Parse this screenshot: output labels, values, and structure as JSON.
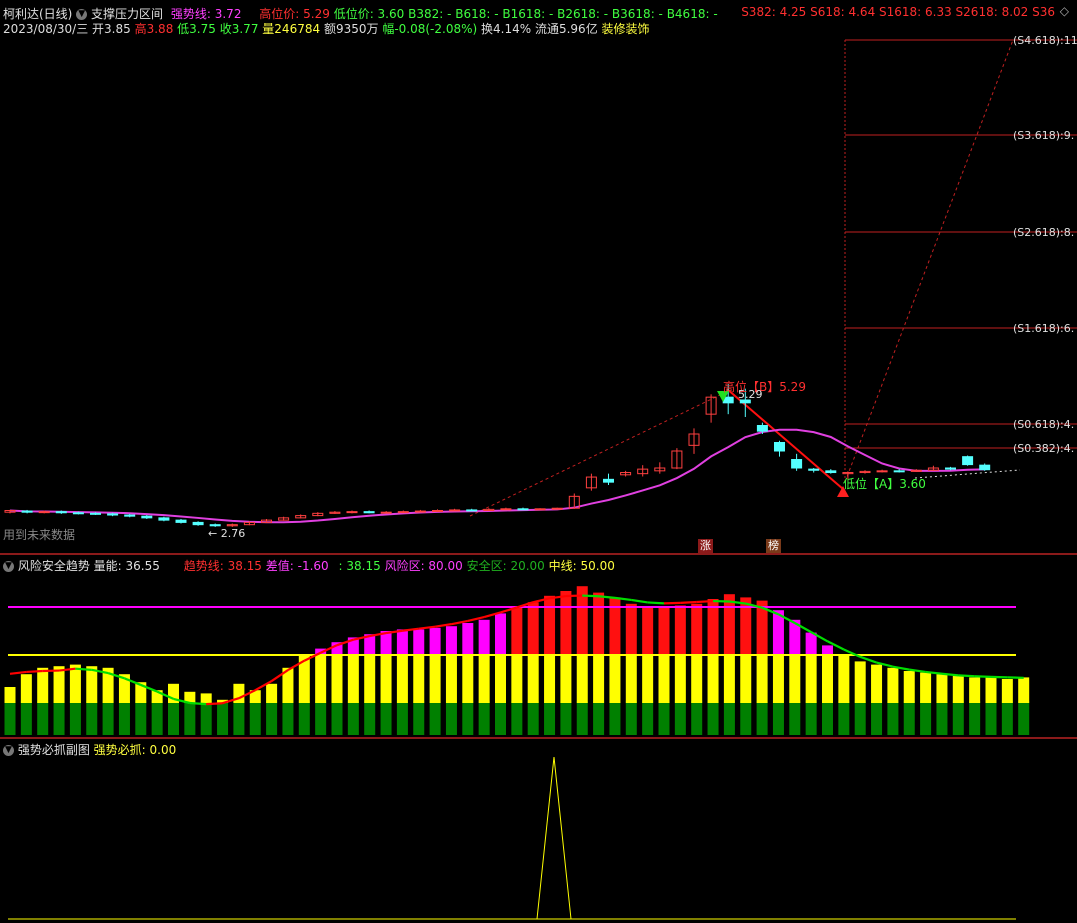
{
  "header": {
    "stock_name": "柯利达(日线)",
    "indicator_name": "支撑压力区间",
    "strong_line": "强势线: 3.72",
    "high_price": "高位价: 5.29",
    "low_price": "低位价: 3.60",
    "b_levels": "B382: -  B618: -  B1618: -  B2618: -  B3618: -  B4618: -",
    "s_levels": "S382: 4.25  S618: 4.64  S1618: 6.33  S2618: 8.02  S36",
    "date": "2023/08/30/三",
    "open": "开3.85",
    "high": "高3.88",
    "low": "低3.75",
    "close": "收3.77",
    "volume": "量246784",
    "amount": "额9350万",
    "change": "幅-0.08(-2.08%)",
    "turnover": "换4.14%",
    "float_cap": "流通5.96亿",
    "sector": "装修装饰"
  },
  "main_chart": {
    "future_data_note": "用到未来数据",
    "low_label": "2.76",
    "peak_label": "5.29",
    "high_marker": "高位【B】5.29",
    "low_marker": "低位【A】3.60",
    "levels": [
      {
        "label": "(S4.618):11",
        "value": 11.0
      },
      {
        "label": "(S3.618):9.",
        "value": 9.7
      },
      {
        "label": "(S2.618):8.",
        "value": 8.02
      },
      {
        "label": "(S1.618):6.",
        "value": 6.33
      },
      {
        "label": "(S0.618):4.",
        "value": 4.64
      },
      {
        "label": "(S0.382):4.",
        "value": 4.25
      }
    ],
    "badges": [
      {
        "text": "涨",
        "color": "#8b1a1a"
      },
      {
        "text": "榜",
        "color": "#7a3a1a"
      }
    ],
    "colors": {
      "up": "#ff4040",
      "down": "#54ffff",
      "ma": "#e040e0",
      "level": "#c02020"
    },
    "candles": [
      [
        3.02,
        3.05,
        3.06,
        3.0
      ],
      [
        3.04,
        3.02,
        3.06,
        3.0
      ],
      [
        3.02,
        3.03,
        3.05,
        3.0
      ],
      [
        3.03,
        3.01,
        3.05,
        2.99
      ],
      [
        3.01,
        3.0,
        3.03,
        2.98
      ],
      [
        3.0,
        2.99,
        3.02,
        2.97
      ],
      [
        2.99,
        2.97,
        3.01,
        2.95
      ],
      [
        2.97,
        2.95,
        2.99,
        2.93
      ],
      [
        2.95,
        2.92,
        2.97,
        2.9
      ],
      [
        2.92,
        2.88,
        2.94,
        2.86
      ],
      [
        2.88,
        2.84,
        2.9,
        2.82
      ],
      [
        2.84,
        2.8,
        2.86,
        2.78
      ],
      [
        2.8,
        2.78,
        2.82,
        2.76
      ],
      [
        2.78,
        2.8,
        2.82,
        2.76
      ],
      [
        2.8,
        2.84,
        2.86,
        2.79
      ],
      [
        2.84,
        2.88,
        2.9,
        2.83
      ],
      [
        2.88,
        2.92,
        2.94,
        2.87
      ],
      [
        2.92,
        2.96,
        2.98,
        2.91
      ],
      [
        2.96,
        3.0,
        3.02,
        2.95
      ],
      [
        3.0,
        3.02,
        3.04,
        2.99
      ],
      [
        3.02,
        3.03,
        3.05,
        3.0
      ],
      [
        3.03,
        3.01,
        3.05,
        3.0
      ],
      [
        3.01,
        3.02,
        3.04,
        3.0
      ],
      [
        3.02,
        3.03,
        3.05,
        3.01
      ],
      [
        3.03,
        3.04,
        3.06,
        3.02
      ],
      [
        3.04,
        3.05,
        3.07,
        3.03
      ],
      [
        3.05,
        3.06,
        3.08,
        3.04
      ],
      [
        3.06,
        3.05,
        3.08,
        3.04
      ],
      [
        3.05,
        3.07,
        3.09,
        3.04
      ],
      [
        3.07,
        3.08,
        3.1,
        3.06
      ],
      [
        3.08,
        3.07,
        3.1,
        3.06
      ],
      [
        3.07,
        3.08,
        3.09,
        3.06
      ],
      [
        3.08,
        3.09,
        3.1,
        3.07
      ],
      [
        3.09,
        3.3,
        3.35,
        3.08
      ],
      [
        3.45,
        3.64,
        3.7,
        3.4
      ],
      [
        3.6,
        3.55,
        3.7,
        3.5
      ],
      [
        3.68,
        3.72,
        3.75,
        3.65
      ],
      [
        3.7,
        3.78,
        3.85,
        3.65
      ],
      [
        3.75,
        3.8,
        3.9,
        3.7
      ],
      [
        3.8,
        4.1,
        4.15,
        3.78
      ],
      [
        4.2,
        4.4,
        4.5,
        4.05
      ],
      [
        4.75,
        5.05,
        5.1,
        4.6
      ],
      [
        5.05,
        4.95,
        5.29,
        4.75
      ],
      [
        5.0,
        4.95,
        5.2,
        4.7
      ],
      [
        4.55,
        4.45,
        4.6,
        4.4
      ],
      [
        4.25,
        4.1,
        4.28,
        4.0
      ],
      [
        3.95,
        3.8,
        4.05,
        3.75
      ],
      [
        3.78,
        3.76,
        3.8,
        3.72
      ],
      [
        3.75,
        3.72,
        3.78,
        3.7
      ],
      [
        3.7,
        3.72,
        3.74,
        3.6
      ],
      [
        3.72,
        3.74,
        3.76,
        3.7
      ],
      [
        3.74,
        3.75,
        3.77,
        3.72
      ],
      [
        3.75,
        3.74,
        3.78,
        3.72
      ],
      [
        3.74,
        3.76,
        3.78,
        3.73
      ],
      [
        3.76,
        3.8,
        3.84,
        3.75
      ],
      [
        3.8,
        3.78,
        3.82,
        3.76
      ],
      [
        4.0,
        3.86,
        4.02,
        3.84
      ],
      [
        3.85,
        3.77,
        3.88,
        3.75
      ]
    ]
  },
  "risk_panel": {
    "title": "风险安全趋势",
    "energy": "量能: 36.55",
    "trend_line": "趋势线: 38.15",
    "diff": "差值: -1.60",
    "value2": ": 38.15",
    "risk_zone": "风险区: 80.00",
    "safe_zone": "安全区: 20.00",
    "mid_line": "中线: 50.00",
    "risk_level": 80,
    "mid_level": 50,
    "safe_level": 20,
    "colors": {
      "risk": "#ff00ff",
      "mid": "#ffff00",
      "safe": "#008000",
      "up": "#ff0000",
      "down": "#00dd00"
    },
    "bars": [
      30,
      38,
      42,
      43,
      44,
      43,
      42,
      38,
      33,
      28,
      20,
      15,
      14,
      10,
      20,
      28,
      32,
      42,
      50,
      54,
      58,
      61,
      63,
      65,
      66,
      66,
      67,
      68,
      70,
      72,
      76,
      80,
      83,
      87,
      90,
      93,
      89,
      86,
      82,
      80,
      80,
      81,
      82,
      85,
      88,
      86,
      84,
      78,
      72,
      64,
      56,
      50,
      46,
      44,
      42,
      40,
      39,
      38,
      37,
      36,
      36,
      35,
      36
    ]
  },
  "strong_panel": {
    "title": "强势必抓副图",
    "value": "强势必抓: 0.00",
    "spike_value": 1
  }
}
